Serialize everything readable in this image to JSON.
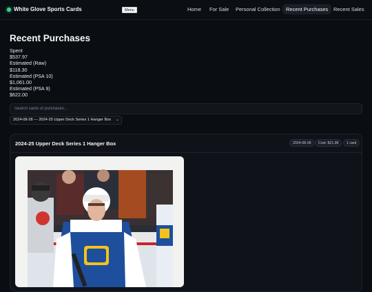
{
  "header": {
    "brand": "White Glove Sports Cards",
    "menu_label": "Menu",
    "nav": [
      {
        "label": "Home"
      },
      {
        "label": "For Sale"
      },
      {
        "label": "Personal Collection"
      },
      {
        "label": "Recent Purchases",
        "active": true
      },
      {
        "label": "Recent Sales"
      }
    ]
  },
  "page": {
    "title": "Recent Purchases",
    "stats": [
      {
        "label": "Spent",
        "value": "$537.97"
      },
      {
        "label": "Estimated (Raw)",
        "value": "$118.30"
      },
      {
        "label": "Estimated (PSA 10)",
        "value": "$1,061.00"
      },
      {
        "label": "Estimated (PSA 9)",
        "value": "$622.00"
      }
    ]
  },
  "search": {
    "placeholder": "Search cards or purchases..."
  },
  "filter": {
    "selected": "2024-08-28 — 2024-25 Upper Deck Series 1 Hanger Box"
  },
  "purchase": {
    "title": "2024-25 Upper Deck Series 1 Hanger Box",
    "date": "2024-08-28",
    "cost": "Cost: $21.98",
    "count": "1 card",
    "image_desc": "hockey-player-photo"
  },
  "colors": {
    "accent_dot": "#3bd38a",
    "background": "#0a0d12",
    "jersey_blue": "#1d4f9c",
    "jersey_yellow": "#f4c21b"
  }
}
